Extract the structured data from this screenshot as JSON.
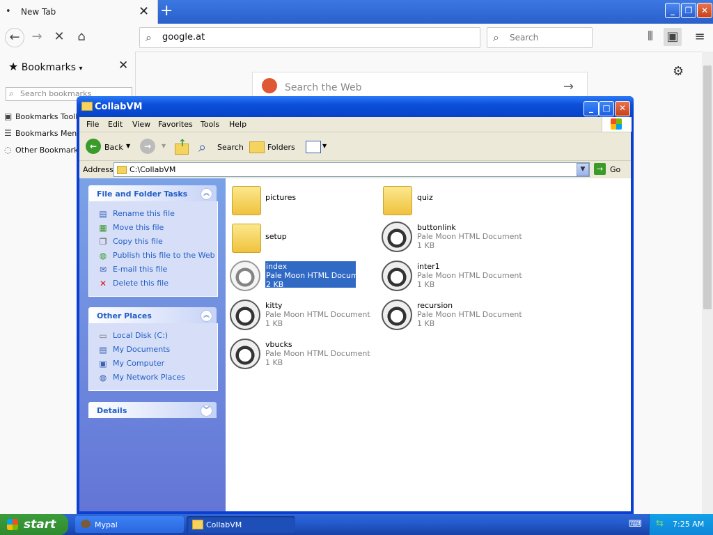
{
  "browser": {
    "tab_title": "New Tab",
    "tab_dot": "•",
    "tab_close": "✕",
    "new_tab": "+",
    "url": "google.at",
    "search_placeholder": "Search",
    "win_min": "_",
    "win_max": "❐",
    "win_close": "✕"
  },
  "sidebar": {
    "title": "Bookmarks",
    "search_placeholder": "Search bookmarks",
    "items": [
      "Bookmarks Toolbar",
      "Bookmarks Menu",
      "Other Bookmarks"
    ]
  },
  "content": {
    "search_placeholder": "Search the Web"
  },
  "explorer": {
    "title": "CollabVM",
    "menu": [
      "File",
      "Edit",
      "View",
      "Favorites",
      "Tools",
      "Help"
    ],
    "toolbar": {
      "back": "Back",
      "search": "Search",
      "folders": "Folders"
    },
    "address_label": "Address",
    "address": "C:\\CollabVM",
    "go": "Go",
    "tasks_title": "File and Folder Tasks",
    "tasks": [
      "Rename this file",
      "Move this file",
      "Copy this file",
      "Publish this file to the Web",
      "E-mail this file",
      "Delete this file"
    ],
    "places_title": "Other Places",
    "places": [
      "Local Disk (C:)",
      "My Documents",
      "My Computer",
      "My Network Places"
    ],
    "details_title": "Details",
    "files": [
      {
        "name": "pictures",
        "type": "",
        "size": "",
        "kind": "folder"
      },
      {
        "name": "quiz",
        "type": "",
        "size": "",
        "kind": "folder"
      },
      {
        "name": "setup",
        "type": "",
        "size": "",
        "kind": "folder"
      },
      {
        "name": "buttonlink",
        "type": "Pale Moon HTML Document",
        "size": "1 KB",
        "kind": "html"
      },
      {
        "name": "index",
        "type": "Pale Moon HTML Document",
        "size": "2 KB",
        "kind": "html"
      },
      {
        "name": "inter1",
        "type": "Pale Moon HTML Document",
        "size": "1 KB",
        "kind": "html"
      },
      {
        "name": "kitty",
        "type": "Pale Moon HTML Document",
        "size": "1 KB",
        "kind": "html"
      },
      {
        "name": "recursion",
        "type": "Pale Moon HTML Document",
        "size": "1 KB",
        "kind": "html"
      },
      {
        "name": "vbucks",
        "type": "Pale Moon HTML Document",
        "size": "1 KB",
        "kind": "html"
      }
    ]
  },
  "taskbar": {
    "start": "start",
    "tasks": [
      "Mypal",
      "CollabVM"
    ],
    "clock": "7:25 AM"
  }
}
